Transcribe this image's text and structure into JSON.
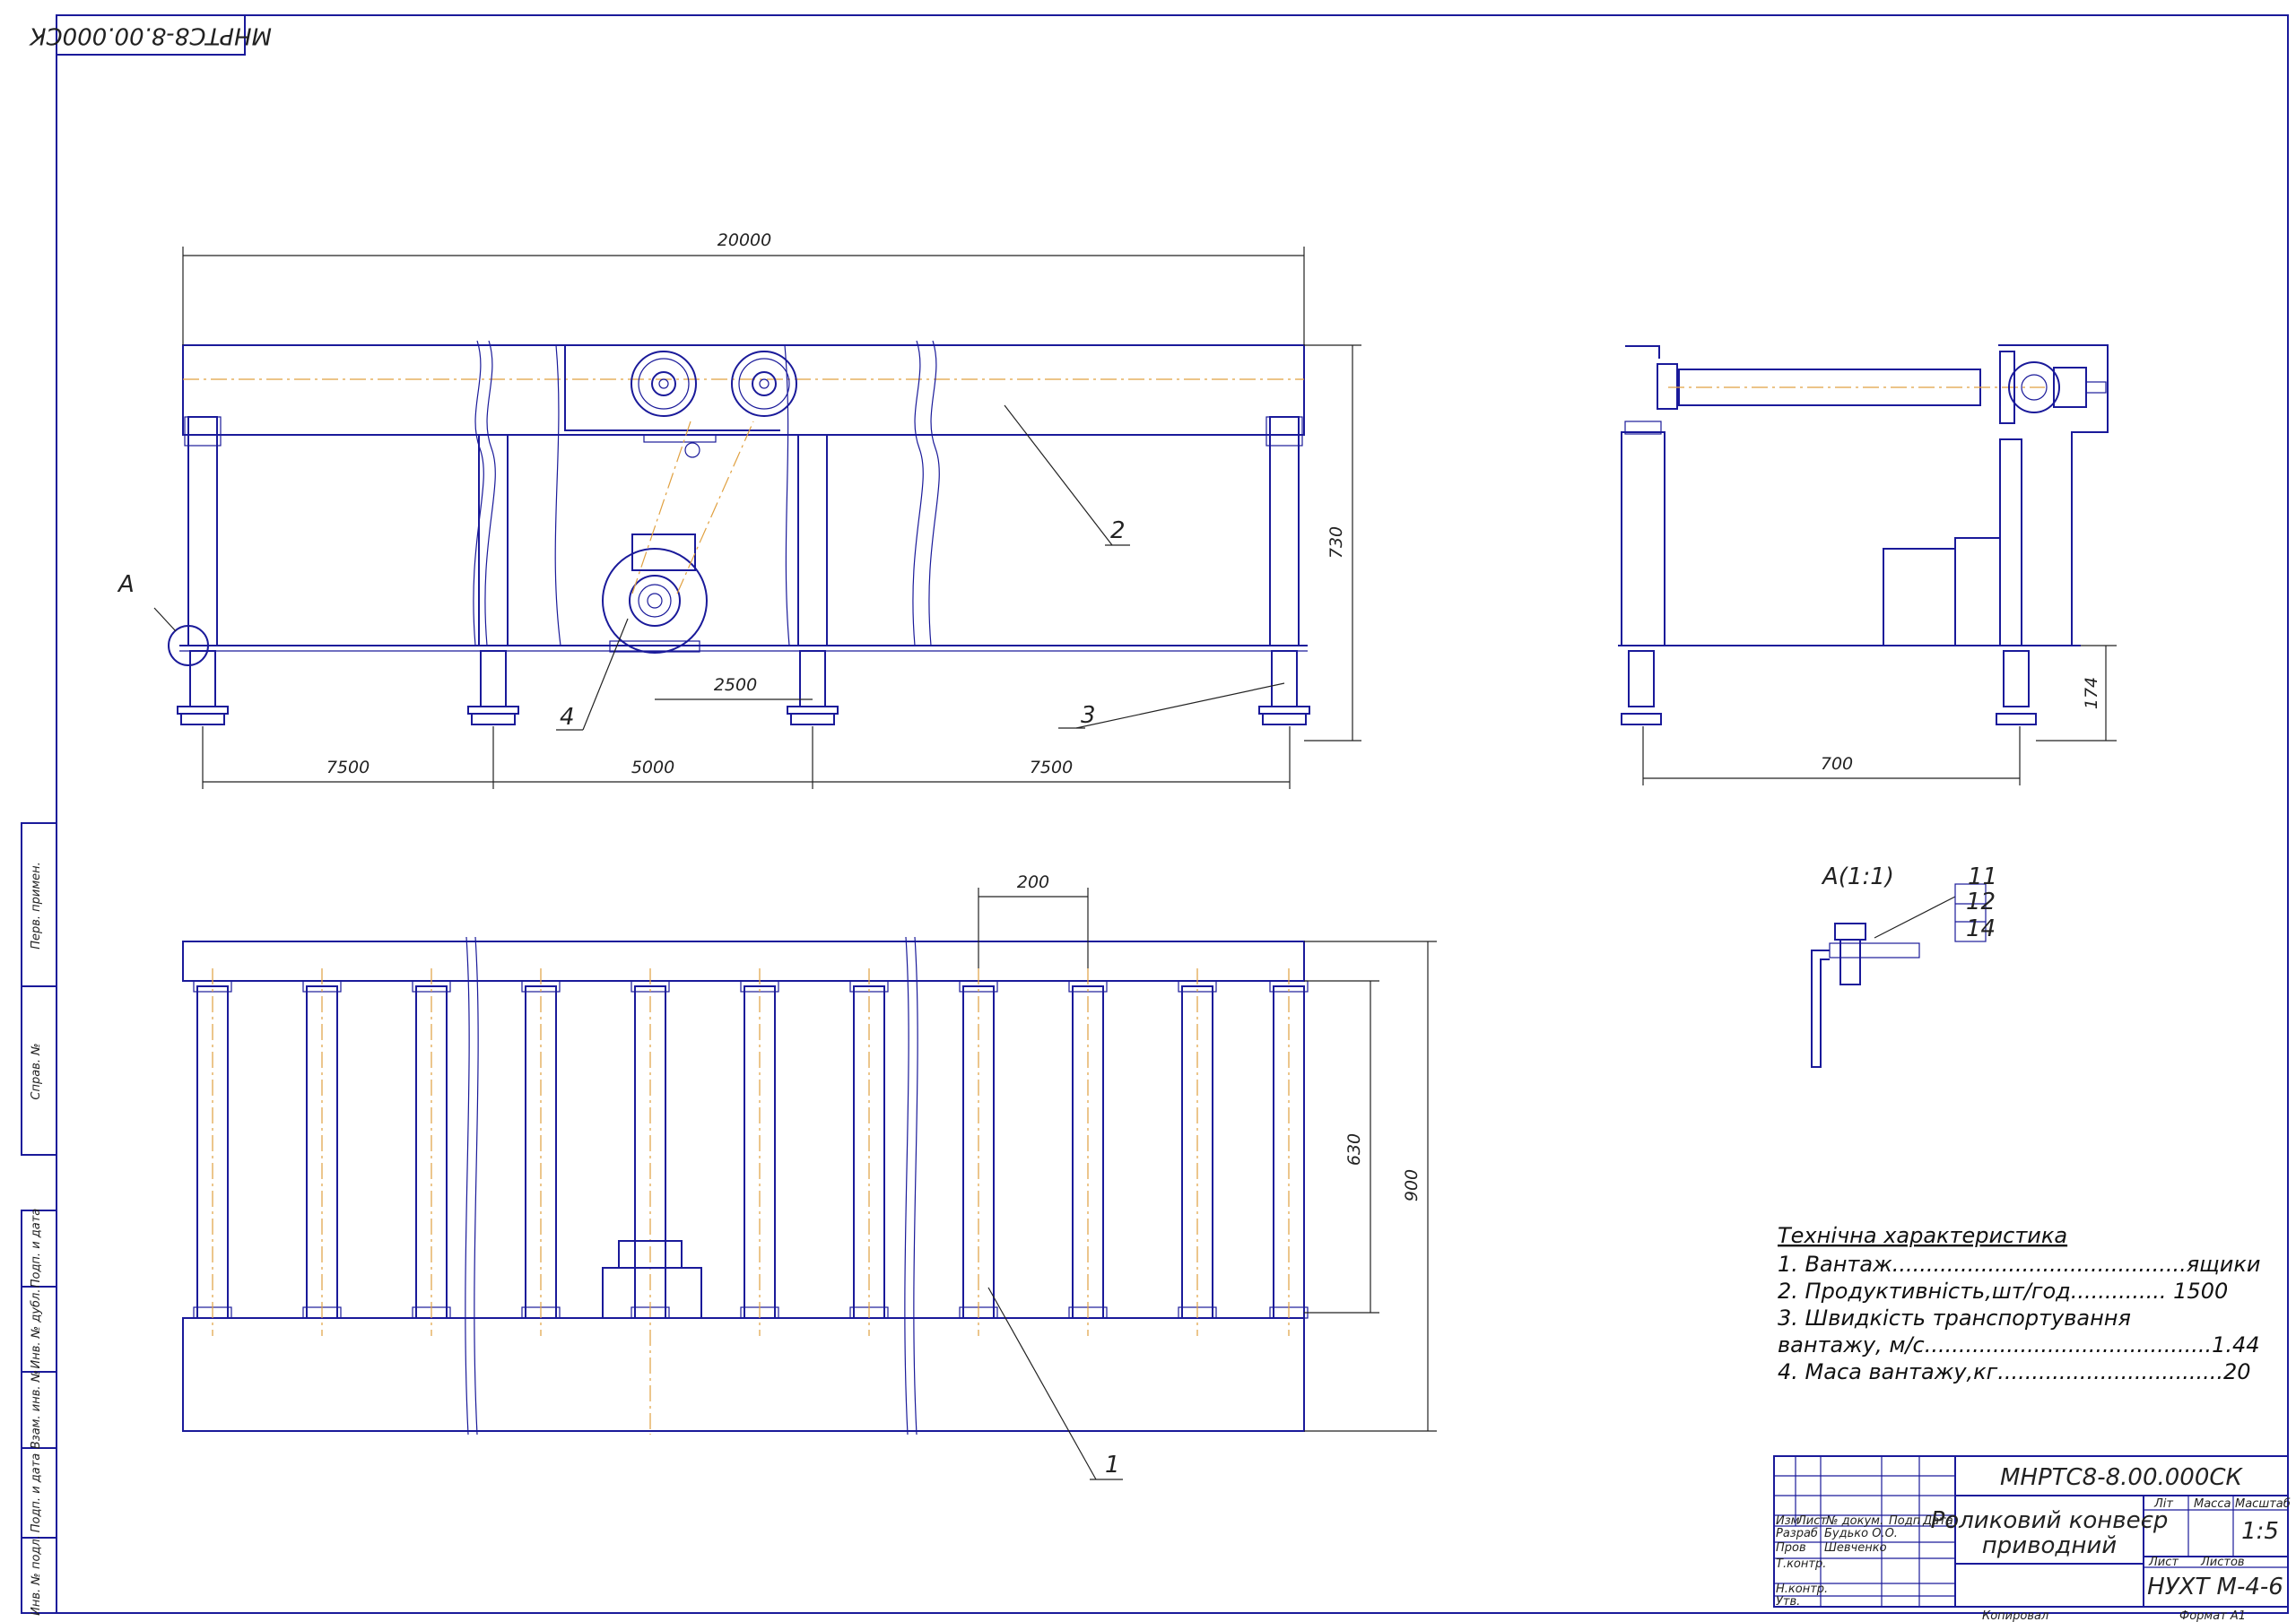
{
  "drawing": {
    "top_stamp": "МНРТС8-8.00.000СК",
    "section_label": "А(1:1)",
    "detail_callout": "А"
  },
  "dimensions": {
    "overall_length": "20000",
    "height": "730",
    "drive_span": "2500",
    "span_left": "7500",
    "span_mid": "5000",
    "span_right": "7500",
    "side_width": "700",
    "leg_height": "174",
    "roller_pitch": "200",
    "roller_length": "630",
    "plan_width": "900"
  },
  "positions": {
    "p1": "1",
    "p2": "2",
    "p3": "3",
    "p4": "4",
    "p11": "11",
    "p12": "12",
    "p14": "14"
  },
  "specs": {
    "title": "Технічна характеристика",
    "line1": "1. Вантаж...........................................ящики",
    "line2": "2. Продуктивність,шт/год.............. 1500",
    "line3": "3. Швидкість транспортування",
    "line4": "вантажу, м/с..........................................1.44",
    "line5": "4. Маса вантажу,кг.................................20"
  },
  "title_block": {
    "code": "МНРТС8-8.00.000СК",
    "name_line1": "Роликовий конвеєр",
    "name_line2": "приводний",
    "org": "НУХТ М-4-6",
    "scale": "1:5",
    "col_lit": "Літ",
    "col_mass": "Масса",
    "col_scale": "Масштаб",
    "sheet": "Лист",
    "sheets": "Листов",
    "hdr_izm": "Изм",
    "hdr_list": "Лист",
    "hdr_doc": "№ докум.",
    "hdr_sign": "Подп",
    "hdr_date": "Дата",
    "role_dev": "Разраб",
    "role_check": "Пров",
    "role_tcontrol": "Т.контр.",
    "role_ncontrol": "Н.контр.",
    "role_approve": "Утв.",
    "name_dev": "Будько О.О.",
    "name_check": "Шевченко",
    "copied": "Копировал",
    "format": "Формат А1"
  },
  "side_stamps": {
    "s1": "Перв. примен.",
    "s2": "Справ. №",
    "s3": "Подп. и дата",
    "s4": "Инв. № дубл.",
    "s5": "Взам. инв. №",
    "s6": "Подп. и дата",
    "s7": "Инв. № подл."
  }
}
